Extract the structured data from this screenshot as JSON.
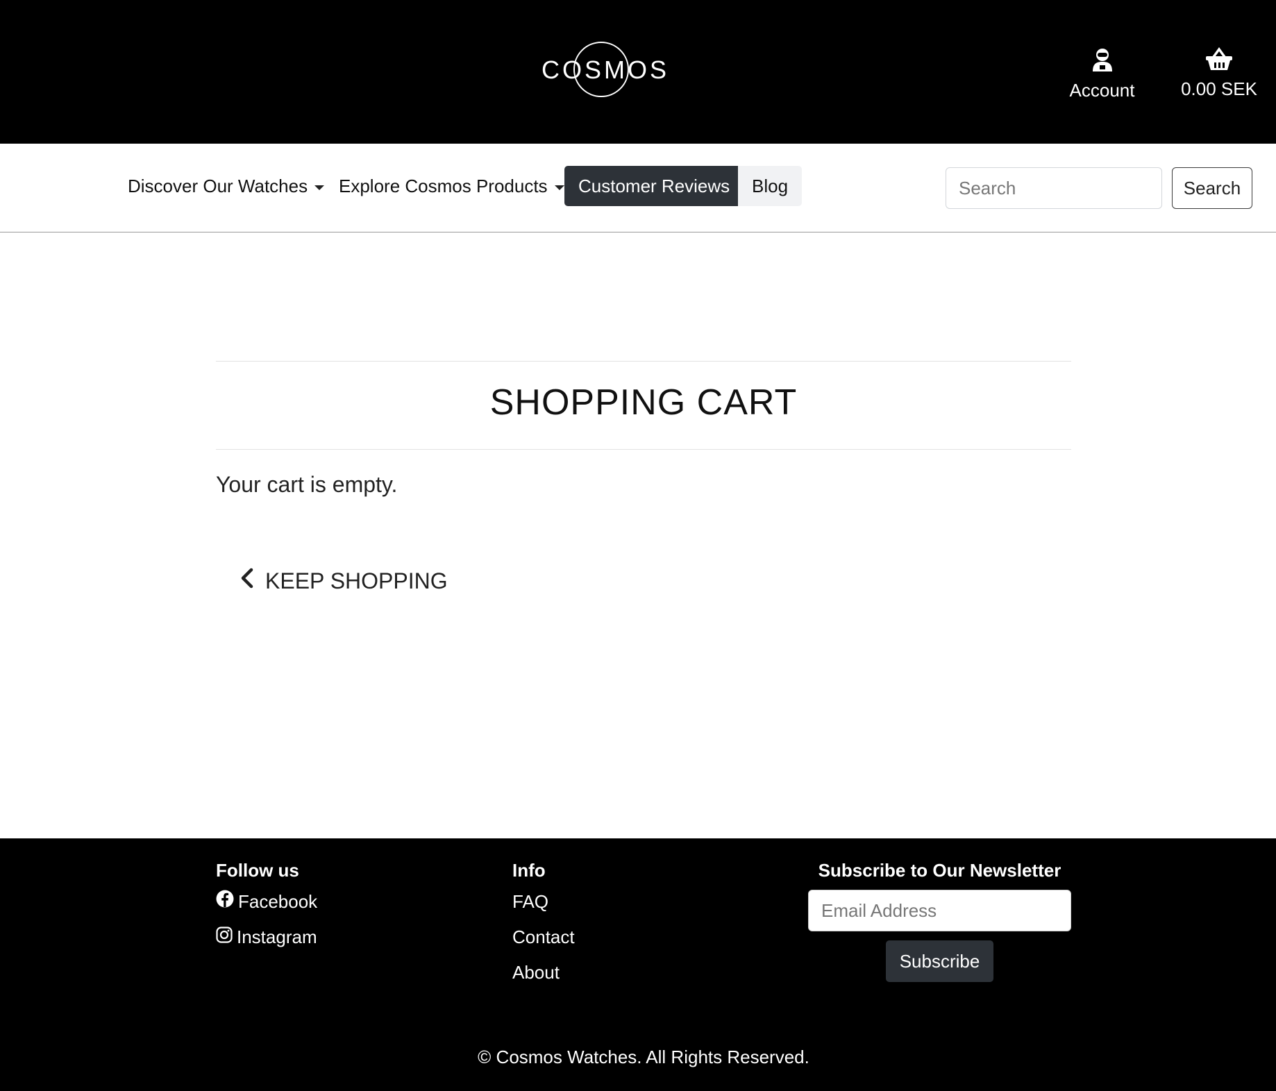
{
  "header": {
    "logo_text": "COSMOS",
    "account_label": "Account",
    "cart_total": "0.00 SEK"
  },
  "nav": {
    "items": [
      {
        "label": "Discover Our Watches",
        "dropdown": true
      },
      {
        "label": "Explore Cosmos Products",
        "dropdown": true
      },
      {
        "label": "Customer Reviews",
        "active": true
      },
      {
        "label": "Blog"
      }
    ],
    "search": {
      "placeholder": "Search",
      "button_label": "Search"
    }
  },
  "main": {
    "title": "SHOPPING CART",
    "empty_message": "Your cart is empty.",
    "keep_shopping_label": "KEEP SHOPPING"
  },
  "footer": {
    "follow": {
      "heading": "Follow us",
      "links": [
        {
          "label": "Facebook",
          "icon": "facebook-icon"
        },
        {
          "label": "Instagram",
          "icon": "instagram-icon"
        }
      ]
    },
    "info": {
      "heading": "Info",
      "links": [
        "FAQ",
        "Contact",
        "About"
      ]
    },
    "newsletter": {
      "heading": "Subscribe to Our Newsletter",
      "email_placeholder": "Email Address",
      "button_label": "Subscribe"
    },
    "copyright": "© Cosmos Watches. All Rights Reserved."
  },
  "colors": {
    "header_bg": "#000000",
    "active_nav_bg": "#2d3238",
    "footer_bg": "#000000"
  }
}
